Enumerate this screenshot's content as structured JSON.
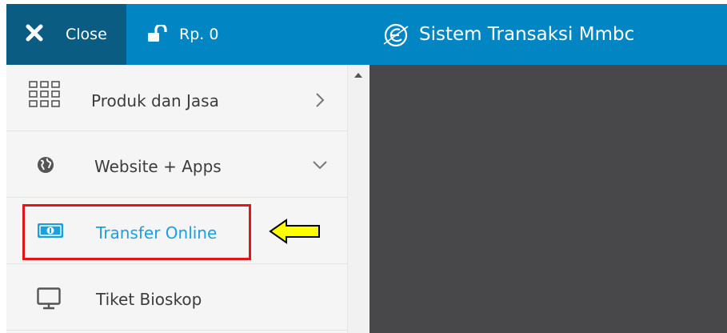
{
  "topbar": {
    "close_label": "Close",
    "balance_label": "Rp. 0",
    "brand_title": "Sistem Transaksi Mmbc",
    "colors": {
      "bar": "#0286c3",
      "close_bg": "#0b5c83"
    }
  },
  "sidebar": {
    "items": [
      {
        "label": "Produk dan Jasa",
        "icon": "grid-icon",
        "chevron": "chevron-right-icon"
      },
      {
        "label": "Website + Apps",
        "icon": "globe-icon",
        "chevron": "chevron-down-icon"
      },
      {
        "label": "Transfer Online",
        "icon": "money-icon",
        "active": true
      },
      {
        "label": "Tiket Bioskop",
        "icon": "monitor-icon"
      }
    ],
    "active_color": "#1a9fe0"
  },
  "annotation": {
    "highlight_color": "#e4141c",
    "arrow_color": "#ffff00"
  }
}
